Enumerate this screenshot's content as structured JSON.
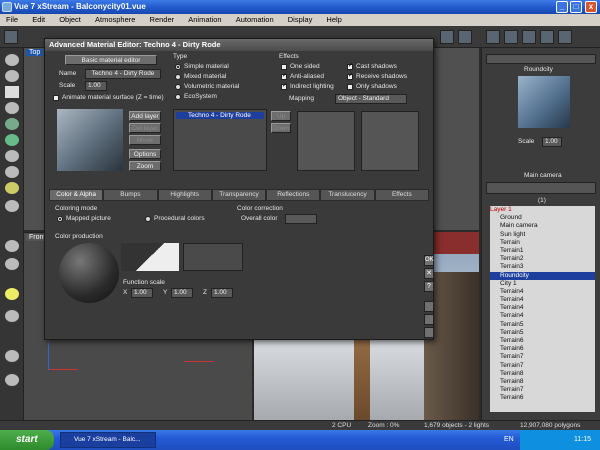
{
  "window": {
    "title": "Vue 7 xStream - Balconycity01.vue",
    "min": "_",
    "max": "□",
    "close": "x"
  },
  "menu": [
    "File",
    "Edit",
    "Object",
    "Atmosphere",
    "Render",
    "Animation",
    "Automation",
    "Display",
    "Help"
  ],
  "viewports": {
    "top": "Top",
    "front": "Front"
  },
  "dialog": {
    "title": "Advanced Material Editor: Techno 4 - Dirty Rode",
    "basic_button": "Basic material editor",
    "name_label": "Name",
    "name_value": "Techno 4 - Dirty Rode",
    "scale_label": "Scale",
    "scale_value": "1.00",
    "animate_label": "Animate material surface (Z = time)",
    "layer_buttons": [
      "Add layer",
      "Del layer",
      "Move",
      "Options",
      "Zoom"
    ],
    "type_title": "Type",
    "type_options": [
      "Simple material",
      "Mixed material",
      "Volumetric material",
      "EcoSystem"
    ],
    "layer_item": "Techno 4 - Dirty Rode",
    "up": "Up",
    "down": "Down",
    "effects_title": "Effects",
    "effects_left": [
      "One sided",
      "Anti-aliased",
      "Indirect lighting"
    ],
    "effects_right": [
      "Cast shadows",
      "Receive shadows",
      "Only shadows"
    ],
    "mapping_label": "Mapping",
    "mapping_value": "Object - Standard",
    "tabs": [
      "Color & Alpha",
      "Bumps",
      "Highlights",
      "Transparency",
      "Reflections",
      "Translucency",
      "Effects"
    ],
    "coloring_mode_title": "Coloring mode",
    "coloring_options": [
      "Mapped picture",
      "Procedural colors"
    ],
    "color_correction_title": "Color correction",
    "overall_color_label": "Overall color",
    "color_production_title": "Color production",
    "function_scale_label": "Function scale",
    "fs_x_label": "X",
    "fs_x": "1.00",
    "fs_y_label": "Y",
    "fs_y": "1.00",
    "fs_z_label": "Z",
    "fs_z": "1.00",
    "side_buttons": [
      "OK",
      "✕",
      "?"
    ]
  },
  "right_panel": {
    "preview_name": "Roundcity",
    "scale_label": "Scale",
    "scale_value": "1.00",
    "camera_label": "Main camera",
    "layer_count": "(1)",
    "tree": [
      "Layer 1",
      "Ground",
      "Main camera",
      "Sun light",
      "Terrain",
      "Terrain1",
      "Terrain2",
      "Terrain3",
      "Roundcity",
      "City 1",
      "Terrain4",
      "Terrain4",
      "Terrain4",
      "Terrain4",
      "Terrain5",
      "Terrain5",
      "Terrain6",
      "Terrain6",
      "Terrain7",
      "Terrain7",
      "Terrain8",
      "Terrain8",
      "Terrain7",
      "Terrain6"
    ]
  },
  "status": {
    "cpu": "2 CPU",
    "zoom": "Zoom : 0%",
    "objects": "1,679 objects - 2 lights",
    "polygons": "12,907,080 polygons"
  },
  "taskbar": {
    "start": "start",
    "task": "Vue 7 xStream - Balc...",
    "lang": "EN",
    "time": "11:15"
  }
}
